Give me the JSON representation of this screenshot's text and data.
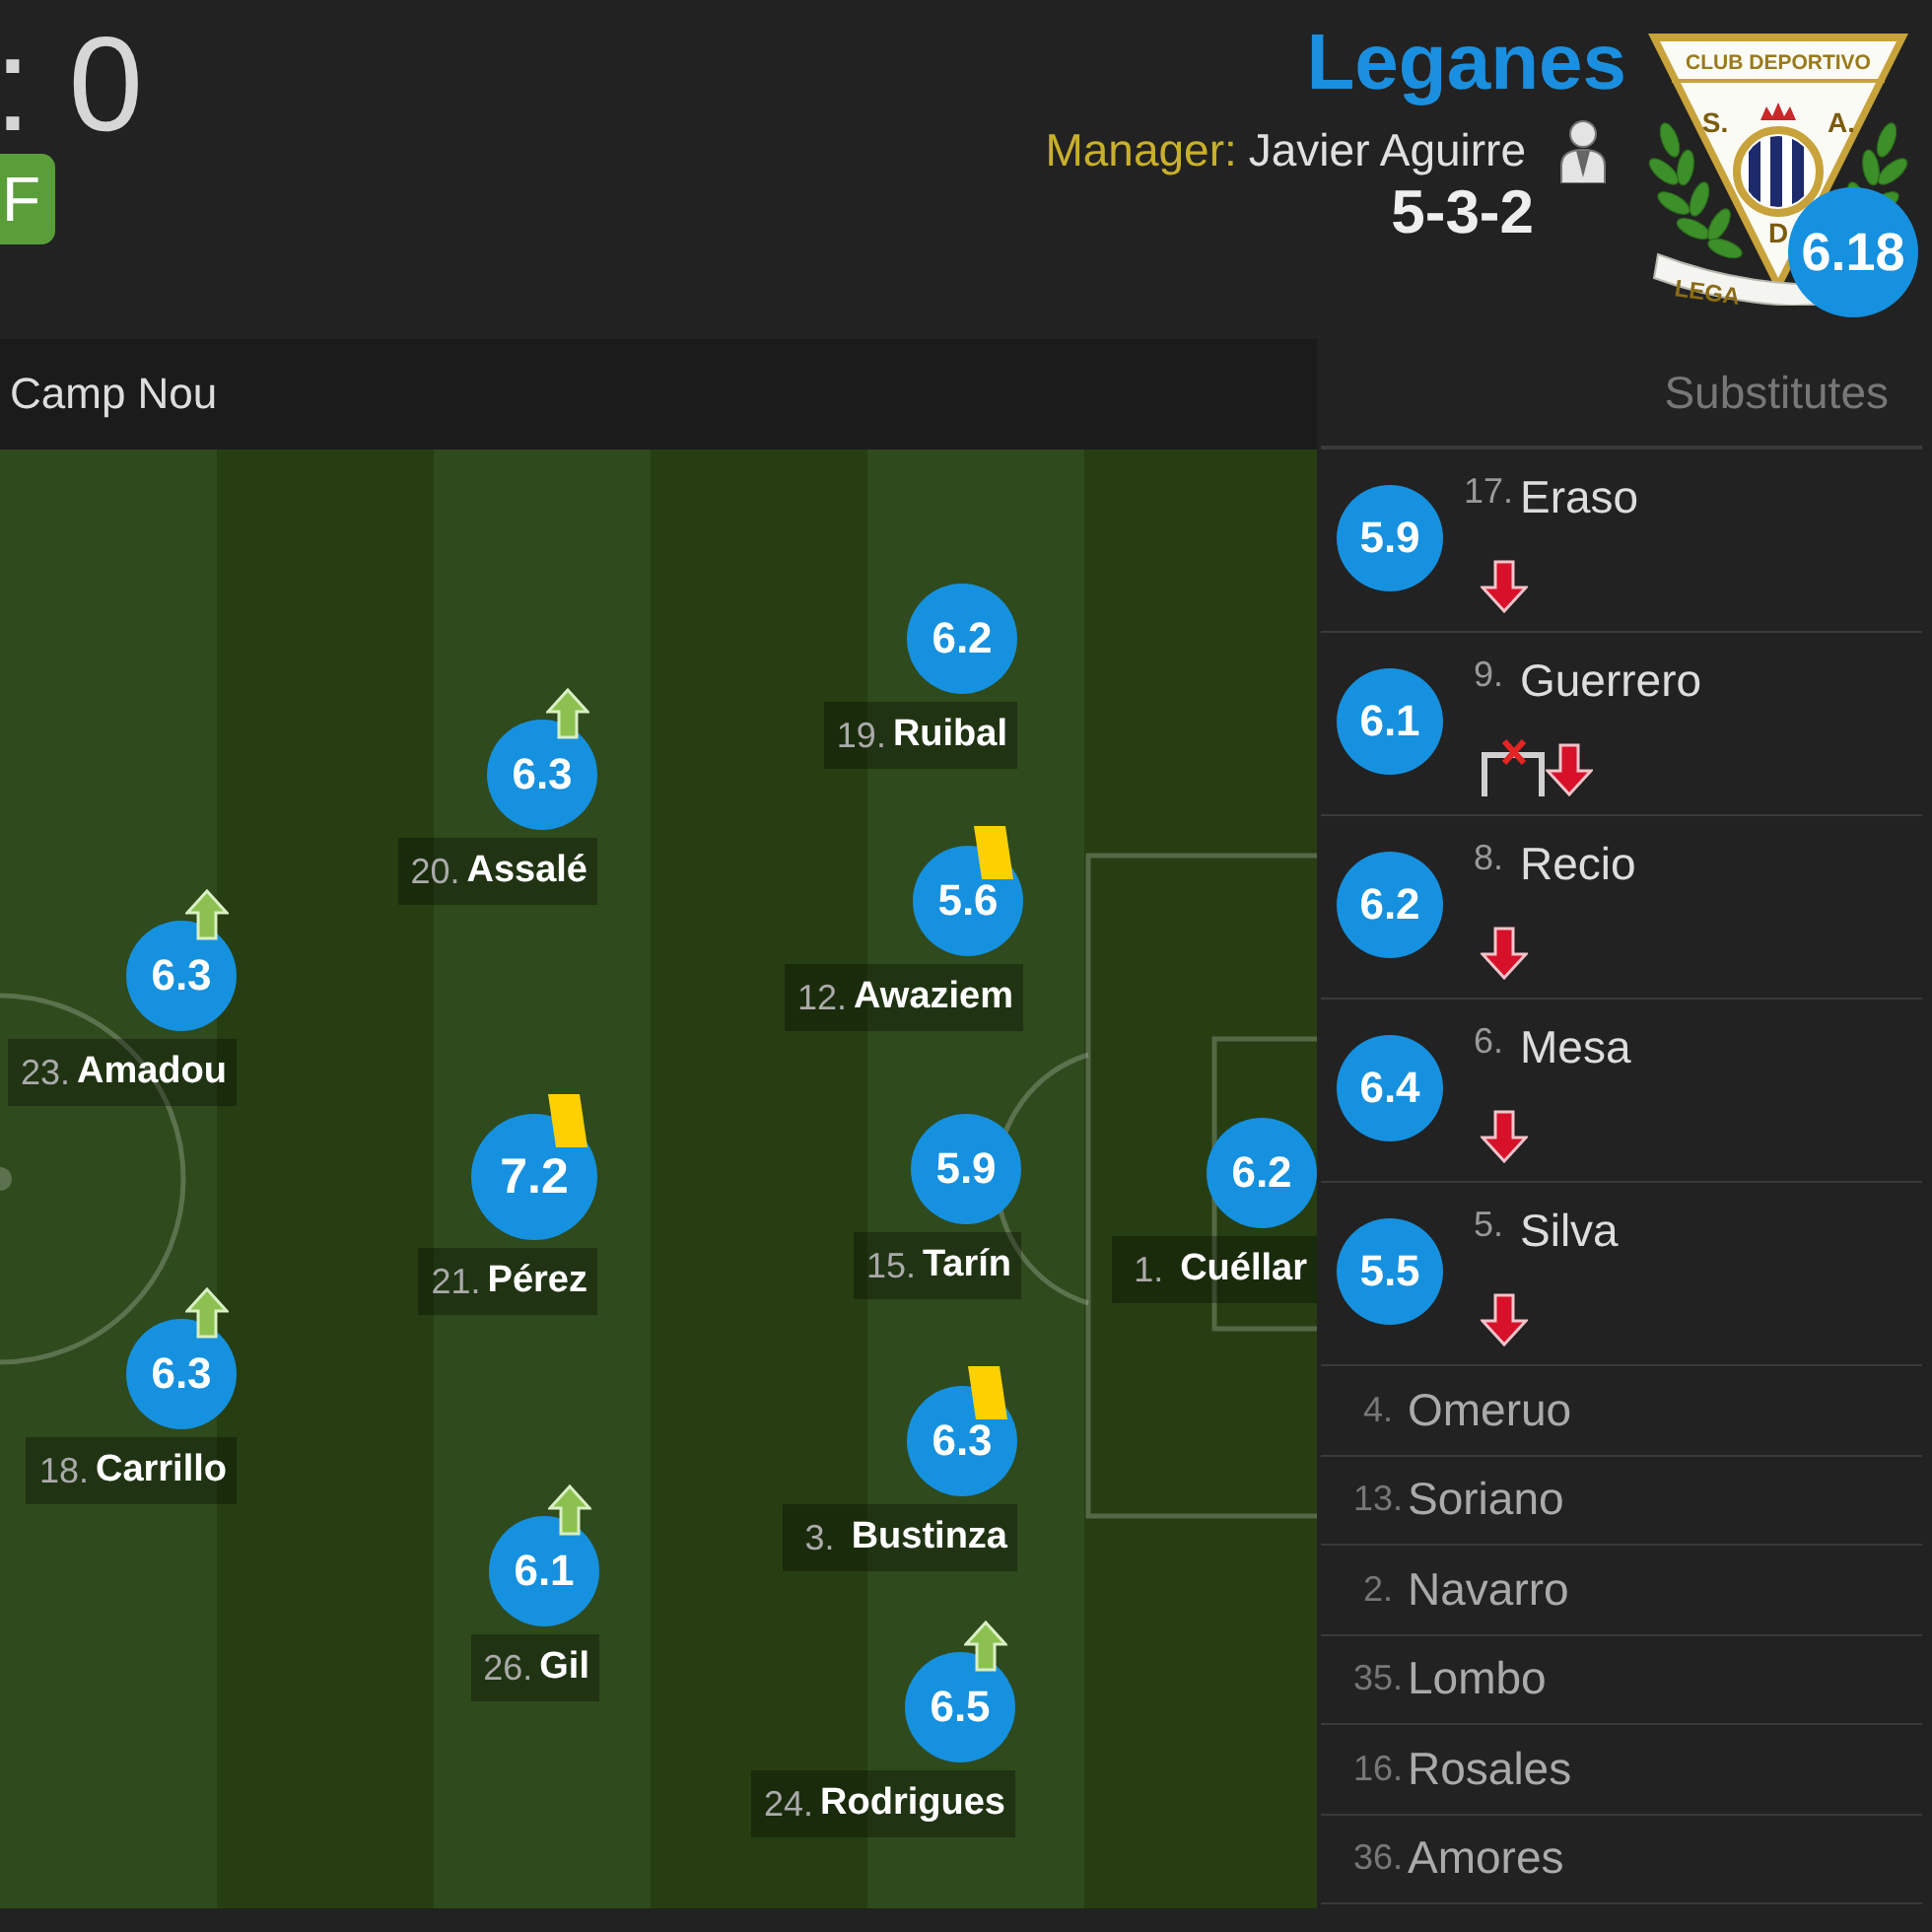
{
  "header": {
    "score": ": 0",
    "status_badge": "F",
    "team": {
      "name": "Leganes",
      "manager_label": "Manager:",
      "manager": "Javier Aguirre",
      "formation": "5-3-2",
      "rating": "6.18",
      "crest": {
        "top_text": "CLUB DEPORTIVO",
        "letters": [
          "S.",
          "A.",
          "D"
        ],
        "ribbon": "LEGA"
      }
    }
  },
  "venue": "Camp Nou",
  "pitch": {
    "players": [
      {
        "number": "23.",
        "name": "Amadou",
        "rating": "6.3",
        "top_rated": false,
        "sub_arrow": true,
        "yellow_card": false
      },
      {
        "number": "18.",
        "name": "Carrillo",
        "rating": "6.3",
        "top_rated": false,
        "sub_arrow": true,
        "yellow_card": false
      },
      {
        "number": "20.",
        "name": "Assalé",
        "rating": "6.3",
        "top_rated": false,
        "sub_arrow": true,
        "yellow_card": false
      },
      {
        "number": "21.",
        "name": "Pérez",
        "rating": "7.2",
        "top_rated": true,
        "sub_arrow": false,
        "yellow_card": true
      },
      {
        "number": "26.",
        "name": "Gil",
        "rating": "6.1",
        "top_rated": false,
        "sub_arrow": true,
        "yellow_card": false
      },
      {
        "number": "19.",
        "name": "Ruibal",
        "rating": "6.2",
        "top_rated": false,
        "sub_arrow": false,
        "yellow_card": false
      },
      {
        "number": "12.",
        "name": "Awaziem",
        "rating": "5.6",
        "top_rated": false,
        "sub_arrow": false,
        "yellow_card": true
      },
      {
        "number": "15.",
        "name": "Tarín",
        "rating": "5.9",
        "top_rated": false,
        "sub_arrow": false,
        "yellow_card": false
      },
      {
        "number": "3.",
        "name": "Bustinza",
        "rating": "6.3",
        "top_rated": false,
        "sub_arrow": false,
        "yellow_card": true
      },
      {
        "number": "24.",
        "name": "Rodrigues",
        "rating": "6.5",
        "top_rated": false,
        "sub_arrow": true,
        "yellow_card": false
      },
      {
        "number": "1.",
        "name": "Cuéllar",
        "rating": "6.2",
        "top_rated": false,
        "sub_arrow": false,
        "yellow_card": false
      }
    ]
  },
  "substitutes": {
    "title": "Substitutes",
    "used": [
      {
        "number": "17.",
        "name": "Eraso",
        "rating": "5.9",
        "goal_cross": false,
        "sub_arrow": true
      },
      {
        "number": "9.",
        "name": "Guerrero",
        "rating": "6.1",
        "goal_cross": true,
        "sub_arrow": true
      },
      {
        "number": "8.",
        "name": "Recio",
        "rating": "6.2",
        "goal_cross": false,
        "sub_arrow": true
      },
      {
        "number": "6.",
        "name": "Mesa",
        "rating": "6.4",
        "goal_cross": false,
        "sub_arrow": true
      },
      {
        "number": "5.",
        "name": "Silva",
        "rating": "5.5",
        "goal_cross": false,
        "sub_arrow": true
      }
    ],
    "unused": [
      {
        "number": "4.",
        "name": "Omeruo"
      },
      {
        "number": "13.",
        "name": "Soriano"
      },
      {
        "number": "2.",
        "name": "Navarro"
      },
      {
        "number": "35.",
        "name": "Lombo"
      },
      {
        "number": "16.",
        "name": "Rosales"
      },
      {
        "number": "36.",
        "name": "Amores"
      }
    ]
  }
}
